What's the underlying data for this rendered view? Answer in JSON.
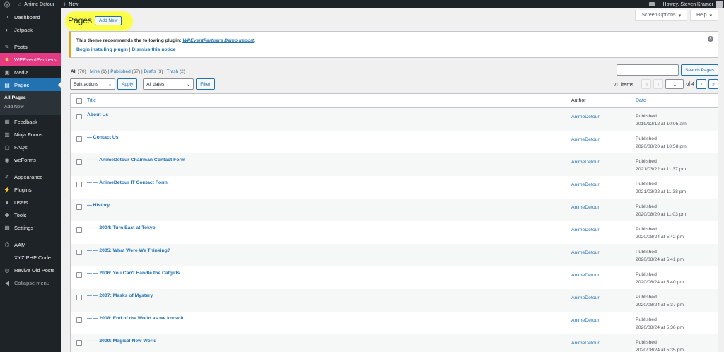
{
  "adminbar": {
    "site_name": "Anime Detour",
    "new_label": "New",
    "greeting": "Howdy, Steven Kramer"
  },
  "sidebar": {
    "items": [
      {
        "label": "Dashboard",
        "icon": "dashboard-icon"
      },
      {
        "label": "Jetpack",
        "icon": "jetpack-icon"
      },
      {
        "label": "Posts",
        "icon": "pin-icon"
      },
      {
        "label": "WPEventPartners",
        "icon": "gear-icon"
      },
      {
        "label": "Media",
        "icon": "media-icon"
      },
      {
        "label": "Pages",
        "icon": "page-icon"
      },
      {
        "label": "Feedback",
        "icon": "feedback-icon"
      },
      {
        "label": "Ninja Forms",
        "icon": "forms-icon"
      },
      {
        "label": "FAQs",
        "icon": "faq-icon"
      },
      {
        "label": "weForms",
        "icon": "weforms-icon"
      },
      {
        "label": "Appearance",
        "icon": "brush-icon"
      },
      {
        "label": "Plugins",
        "icon": "plugin-icon"
      },
      {
        "label": "Users",
        "icon": "user-icon"
      },
      {
        "label": "Tools",
        "icon": "wrench-icon"
      },
      {
        "label": "Settings",
        "icon": "settings-icon"
      },
      {
        "label": "AAM",
        "icon": "aam-icon"
      },
      {
        "label": "XYZ PHP Code",
        "icon": "code-icon"
      },
      {
        "label": "Revive Old Posts",
        "icon": "revive-icon"
      },
      {
        "label": "Collapse menu",
        "icon": "collapse-icon"
      }
    ],
    "submenu": [
      "All Pages",
      "Add New"
    ],
    "highlight_color": "#e33a83",
    "current_color": "#2271b1"
  },
  "screen_meta": {
    "screen_options": "Screen Options",
    "help": "Help"
  },
  "heading": {
    "title": "Pages",
    "add_new": "Add New"
  },
  "notice": {
    "text": "This theme recommends the following plugin:",
    "plugin": "WPEventPartners Demo Import",
    "begin": "Begin installing plugin",
    "separator": "|",
    "dismiss": "Dismiss this notice"
  },
  "filters": {
    "all": "All",
    "all_count": "(70)",
    "mine": "Mine",
    "mine_count": "(1)",
    "published": "Published",
    "published_count": "(67)",
    "drafts": "Drafts",
    "drafts_count": "(3)",
    "trash": "Trash",
    "trash_count": "(2)",
    "sep": "|"
  },
  "search": {
    "button": "Search Pages"
  },
  "tablenav": {
    "bulk_actions": "Bulk actions",
    "apply": "Apply",
    "dates": "All dates",
    "filter": "Filter",
    "items": "70 items",
    "first": "«",
    "prev": "‹",
    "current_page": "1",
    "of_pages": "of 4",
    "next": "›",
    "last": "»"
  },
  "table": {
    "headers": {
      "title": "Title",
      "author": "Author",
      "date": "Date"
    },
    "rows": [
      {
        "title": "About Us",
        "author": "AnimeDetour",
        "status": "Published",
        "date": "2019/12/12 at 10:05 am"
      },
      {
        "title": "— Contact Us",
        "author": "AnimeDetour",
        "status": "Published",
        "date": "2020/08/20 at 10:58 pm"
      },
      {
        "title": "— — AnimeDetour Chairman Contact Form",
        "author": "AnimeDetour",
        "status": "Published",
        "date": "2021/03/22 at 11:37 pm"
      },
      {
        "title": "— — AnimeDetour IT Contact Form",
        "author": "AnimeDetour",
        "status": "Published",
        "date": "2021/03/22 at 11:38 pm"
      },
      {
        "title": "— History",
        "author": "AnimeDetour",
        "status": "Published",
        "date": "2020/08/20 at 11:03 pm"
      },
      {
        "title": "— — 2004: Turn East at Tokyo",
        "author": "AnimeDetour",
        "status": "Published",
        "date": "2020/08/24 at 5:42 pm"
      },
      {
        "title": "— — 2005: What Were We Thinking?",
        "author": "AnimeDetour",
        "status": "Published",
        "date": "2020/08/24 at 5:41 pm"
      },
      {
        "title": "— — 2006: You Can't Handle the Catgirls",
        "author": "AnimeDetour",
        "status": "Published",
        "date": "2020/08/24 at 5:40 pm"
      },
      {
        "title": "— — 2007: Masks of Mystery",
        "author": "AnimeDetour",
        "status": "Published",
        "date": "2020/08/24 at 5:37 pm"
      },
      {
        "title": "— — 2008: End of the World as we know it",
        "author": "AnimeDetour",
        "status": "Published",
        "date": "2020/08/24 at 5:36 pm"
      },
      {
        "title": "— — 2009: Magical New World",
        "author": "AnimeDetour",
        "status": "Published",
        "date": "2020/08/24 at 5:35 pm"
      }
    ]
  }
}
